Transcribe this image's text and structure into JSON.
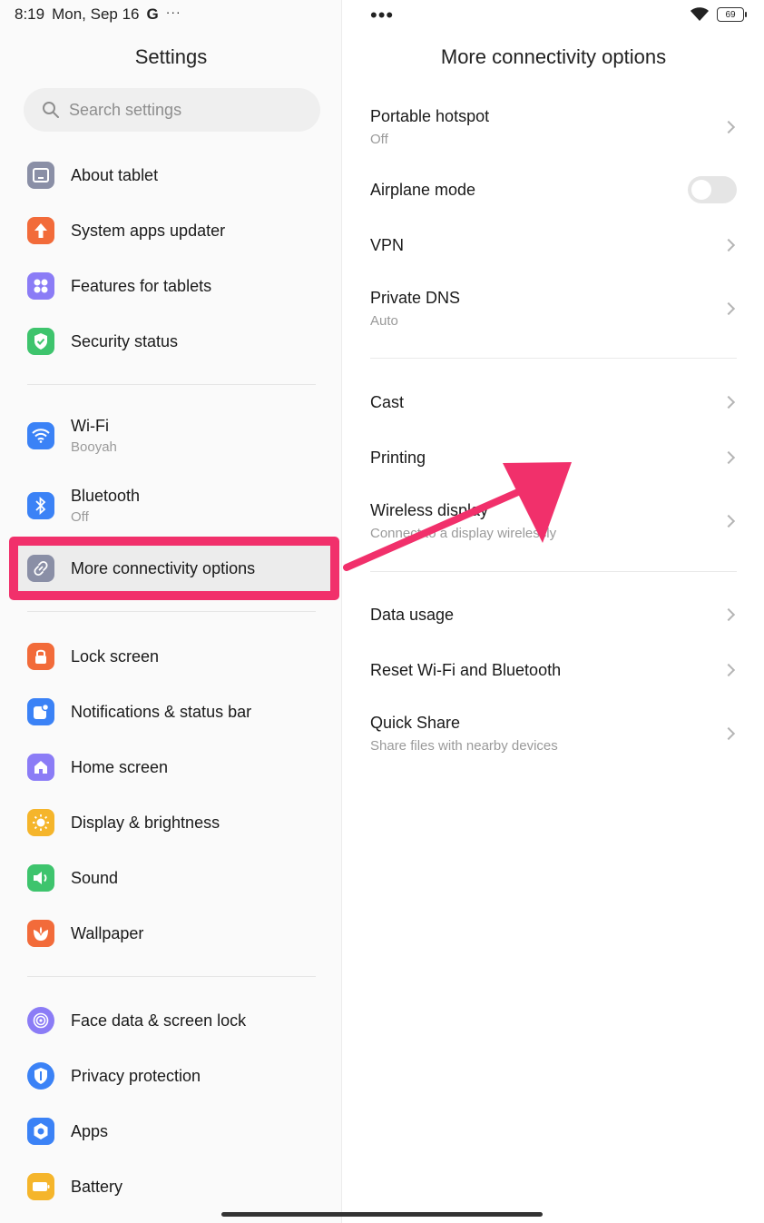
{
  "status_bar": {
    "time": "8:19",
    "date": "Mon, Sep 16",
    "google": "G",
    "more": "···",
    "battery": "69"
  },
  "left_panel": {
    "title": "Settings",
    "search_placeholder": "Search settings",
    "groups": [
      [
        {
          "label": "About tablet",
          "icon": "tablet-icon",
          "color": "#8a8fa6"
        },
        {
          "label": "System apps updater",
          "icon": "update-arrow-icon",
          "color": "#f26b3a"
        },
        {
          "label": "Features for tablets",
          "icon": "grid-icon",
          "color": "#8b7cf6"
        },
        {
          "label": "Security status",
          "icon": "shield-check-icon",
          "color": "#3ec46d"
        }
      ],
      [
        {
          "label": "Wi-Fi",
          "sub": "Booyah",
          "icon": "wifi-icon",
          "color": "#3b82f6"
        },
        {
          "label": "Bluetooth",
          "sub": "Off",
          "icon": "bluetooth-icon",
          "color": "#3b82f6"
        },
        {
          "label": "More connectivity options",
          "icon": "link-icon",
          "color": "#8a8fa6"
        }
      ],
      [
        {
          "label": "Lock screen",
          "icon": "lock-icon",
          "color": "#f26b3a"
        },
        {
          "label": "Notifications & status bar",
          "icon": "notification-icon",
          "color": "#3b82f6"
        },
        {
          "label": "Home screen",
          "icon": "home-icon",
          "color": "#8b7cf6"
        },
        {
          "label": "Display & brightness",
          "icon": "sun-icon",
          "color": "#f5b52b"
        },
        {
          "label": "Sound",
          "icon": "speaker-icon",
          "color": "#3ec46d"
        },
        {
          "label": "Wallpaper",
          "icon": "flower-icon",
          "color": "#f26b3a"
        }
      ],
      [
        {
          "label": "Face data & screen lock",
          "icon": "face-id-icon",
          "color": "#8b7cf6"
        },
        {
          "label": "Privacy protection",
          "icon": "privacy-icon",
          "color": "#3b82f6"
        },
        {
          "label": "Apps",
          "icon": "apps-gear-icon",
          "color": "#3b82f6"
        },
        {
          "label": "Battery",
          "icon": "battery-icon",
          "color": "#f5b52b"
        }
      ]
    ]
  },
  "right_panel": {
    "title": "More connectivity options",
    "items": [
      {
        "label": "Portable hotspot",
        "sub": "Off",
        "control": "chevron"
      },
      {
        "label": "Airplane mode",
        "control": "toggle",
        "on": false
      },
      {
        "label": "VPN",
        "control": "chevron"
      },
      {
        "label": "Private DNS",
        "sub": "Auto",
        "control": "chevron"
      },
      {
        "label": "Cast",
        "control": "chevron"
      },
      {
        "label": "Printing",
        "control": "chevron"
      },
      {
        "label": "Wireless display",
        "sub": "Connect to a display wirelessly",
        "control": "chevron"
      },
      {
        "label": "Data usage",
        "control": "chevron"
      },
      {
        "label": "Reset Wi-Fi and Bluetooth",
        "control": "chevron"
      },
      {
        "label": "Quick Share",
        "sub": "Share files with nearby devices",
        "control": "chevron"
      }
    ]
  },
  "annotation_color": "#f1306b"
}
